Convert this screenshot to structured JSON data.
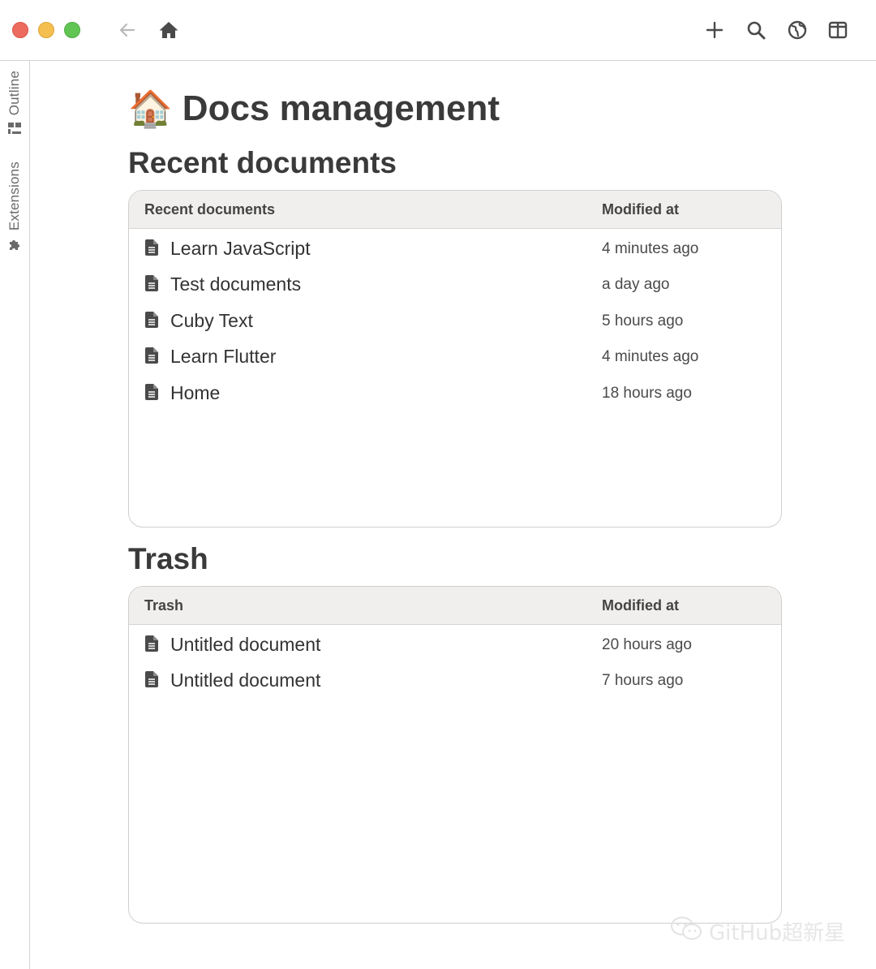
{
  "sidebar": {
    "outline_label": "Outline",
    "extensions_label": "Extensions"
  },
  "page": {
    "emoji": "🏠",
    "title": "Docs management"
  },
  "recent": {
    "heading": "Recent documents",
    "columns": [
      "Recent documents",
      "Modified at"
    ],
    "rows": [
      {
        "name": "Learn JavaScript",
        "modified": "4 minutes ago"
      },
      {
        "name": "Test documents",
        "modified": "a day ago"
      },
      {
        "name": "Cuby Text",
        "modified": "5 hours ago"
      },
      {
        "name": "Learn Flutter",
        "modified": "4 minutes ago"
      },
      {
        "name": "Home",
        "modified": "18 hours ago"
      }
    ]
  },
  "trash": {
    "heading": "Trash",
    "columns": [
      "Trash",
      "Modified at"
    ],
    "rows": [
      {
        "name": "Untitled document",
        "modified": "20 hours ago"
      },
      {
        "name": "Untitled document",
        "modified": "7 hours ago"
      }
    ]
  },
  "watermark": "GitHub超新星",
  "colors": {
    "traffic_red": "#ed6a5e",
    "traffic_yellow": "#f5bf4f",
    "traffic_green": "#61c554",
    "header_bg": "#f0efed",
    "text": "#3a3a3a"
  },
  "icons": [
    "back-arrow-icon",
    "home-icon",
    "plus-icon",
    "search-icon",
    "globe-icon",
    "split-view-icon",
    "outline-icon",
    "puzzle-icon",
    "document-icon",
    "wechat-icon"
  ]
}
